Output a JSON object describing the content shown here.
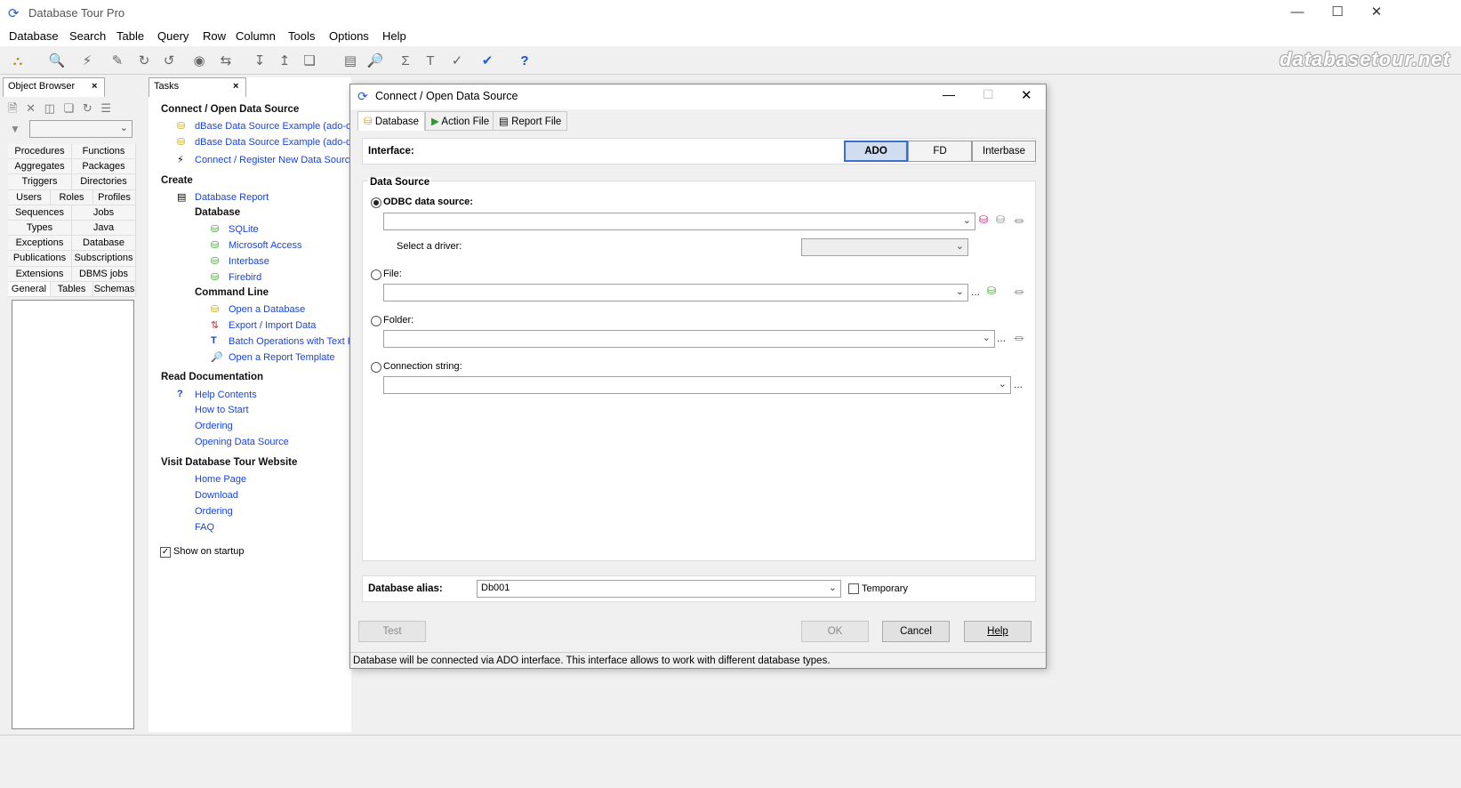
{
  "app": {
    "title": "Database Tour Pro",
    "watermark": "databasetour.net"
  },
  "menu": [
    "Database",
    "Search",
    "Table",
    "Query",
    "Row",
    "Column",
    "Tools",
    "Options",
    "Help"
  ],
  "object_browser": {
    "tab_label": "Object Browser",
    "grid": [
      [
        "Procedures",
        "Functions"
      ],
      [
        "Aggregates",
        "Packages"
      ],
      [
        "Triggers",
        "Directories"
      ],
      [
        "Users",
        "Roles",
        "Profiles"
      ],
      [
        "Sequences",
        "Jobs"
      ],
      [
        "Types",
        "Java"
      ],
      [
        "Exceptions",
        "Database links"
      ],
      [
        "Publications",
        "Subscriptions"
      ],
      [
        "Extensions",
        "DBMS jobs"
      ],
      [
        "General",
        "Tables",
        "Schemas"
      ]
    ]
  },
  "tasks": {
    "tab_label": "Tasks",
    "connect_heading": "Connect / Open Data Source",
    "connect_items": [
      "dBase Data Source Example (ado-odbc)",
      "dBase Data Source Example (ado-direct)",
      "Connect / Register New Data Source..."
    ],
    "create_heading": "Create",
    "db_report": "Database Report",
    "database_subheading": "Database",
    "database_items": [
      "SQLite",
      "Microsoft Access",
      "Interbase",
      "Firebird"
    ],
    "cmdline_subheading": "Command Line",
    "cmdline_items": [
      "Open a Database",
      "Export / Import Data",
      "Batch Operations with Text Fields",
      "Open a Report Template"
    ],
    "docs_heading": "Read Documentation",
    "docs_items": [
      "Help Contents",
      "How to Start",
      "Ordering",
      "Opening Data Source"
    ],
    "website_heading": "Visit Database Tour Website",
    "website_items": [
      "Home Page",
      "Download",
      "Ordering",
      "FAQ"
    ],
    "show_on_startup": "Show on startup"
  },
  "dialog": {
    "title": "Connect / Open Data Source",
    "tabs": [
      "Database",
      "Action File",
      "Report File"
    ],
    "interface_label": "Interface:",
    "interface_options": [
      "ADO",
      "FD",
      "Interbase"
    ],
    "interface_selected": "ADO",
    "data_source_legend": "Data Source",
    "odbc_label": "ODBC data source:",
    "driver_label": "Select a driver:",
    "file_label": "File:",
    "folder_label": "Folder:",
    "connstr_label": "Connection string:",
    "alias_label": "Database alias:",
    "alias_value": "Db001",
    "temporary_label": "Temporary",
    "buttons": {
      "test": "Test",
      "ok": "OK",
      "cancel": "Cancel",
      "help": "Help"
    },
    "status": "Database will be connected via ADO interface. This interface allows to work with different database types."
  },
  "colors": {
    "link": "#1a44d8",
    "selected_border": "#3b70c9"
  }
}
